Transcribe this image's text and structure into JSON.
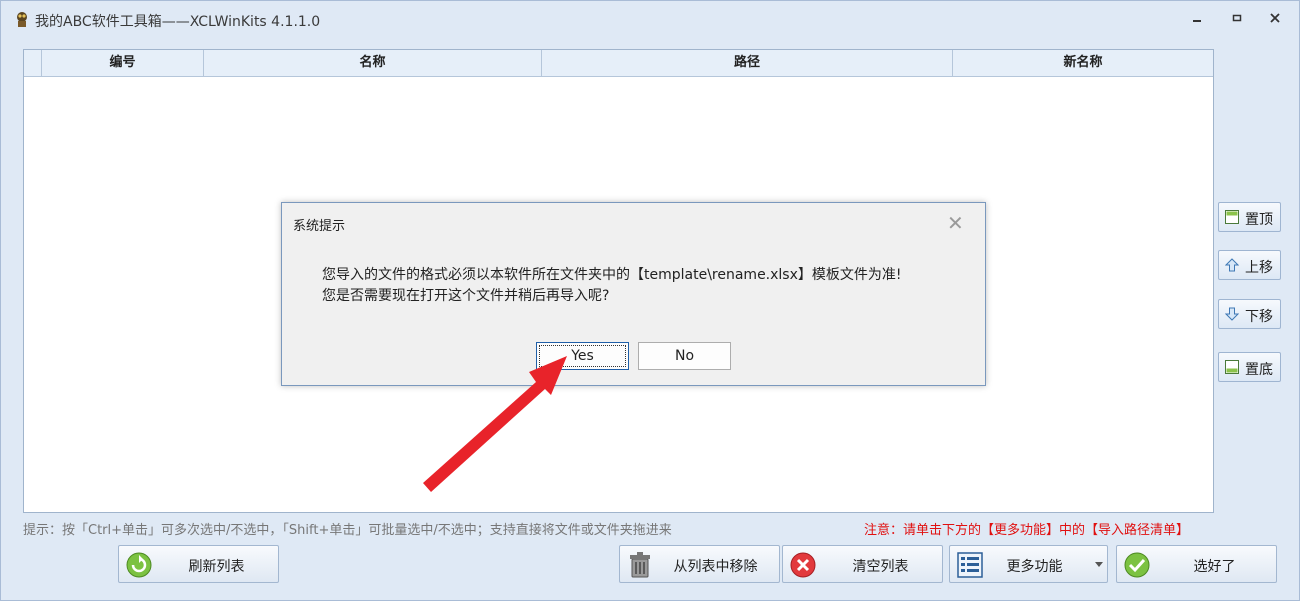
{
  "window": {
    "title": "我的ABC软件工具箱——XCLWinKits  4.1.1.0",
    "controls": [
      "minimize",
      "restore",
      "close"
    ]
  },
  "grid": {
    "columns": [
      "",
      "编号",
      "名称",
      "路径",
      "新名称"
    ],
    "rows": []
  },
  "side_buttons": [
    {
      "label": "置顶",
      "icon": "move-top-icon"
    },
    {
      "label": "上移",
      "icon": "move-up-icon"
    },
    {
      "label": "下移",
      "icon": "move-down-icon"
    },
    {
      "label": "置底",
      "icon": "move-bottom-icon"
    }
  ],
  "tip_text": "提示：按「Ctrl+单击」可多次选中/不选中，「Shift+单击」可批量选中/不选中；支持直接将文件或文件夹拖进来",
  "note_text": "注意：请单击下方的【更多功能】中的【导入路径清单】",
  "bottom_buttons": {
    "refresh": "刷新列表",
    "remove": "从列表中移除",
    "clear": "清空列表",
    "more": "更多功能",
    "done": "选好了"
  },
  "dialog": {
    "title": "系统提示",
    "message_line1": "您导入的文件的格式必须以本软件所在文件夹中的【template\\rename.xlsx】模板文件为准!",
    "message_line2": "您是否需要现在打开这个文件并稍后再导入呢?",
    "yes_label": "Yes",
    "no_label": "No"
  },
  "colors": {
    "accent": "#1f5fa8",
    "note_red": "#e01010",
    "arrow_red": "#e8232a",
    "window_bg": "#dfe9f5"
  }
}
